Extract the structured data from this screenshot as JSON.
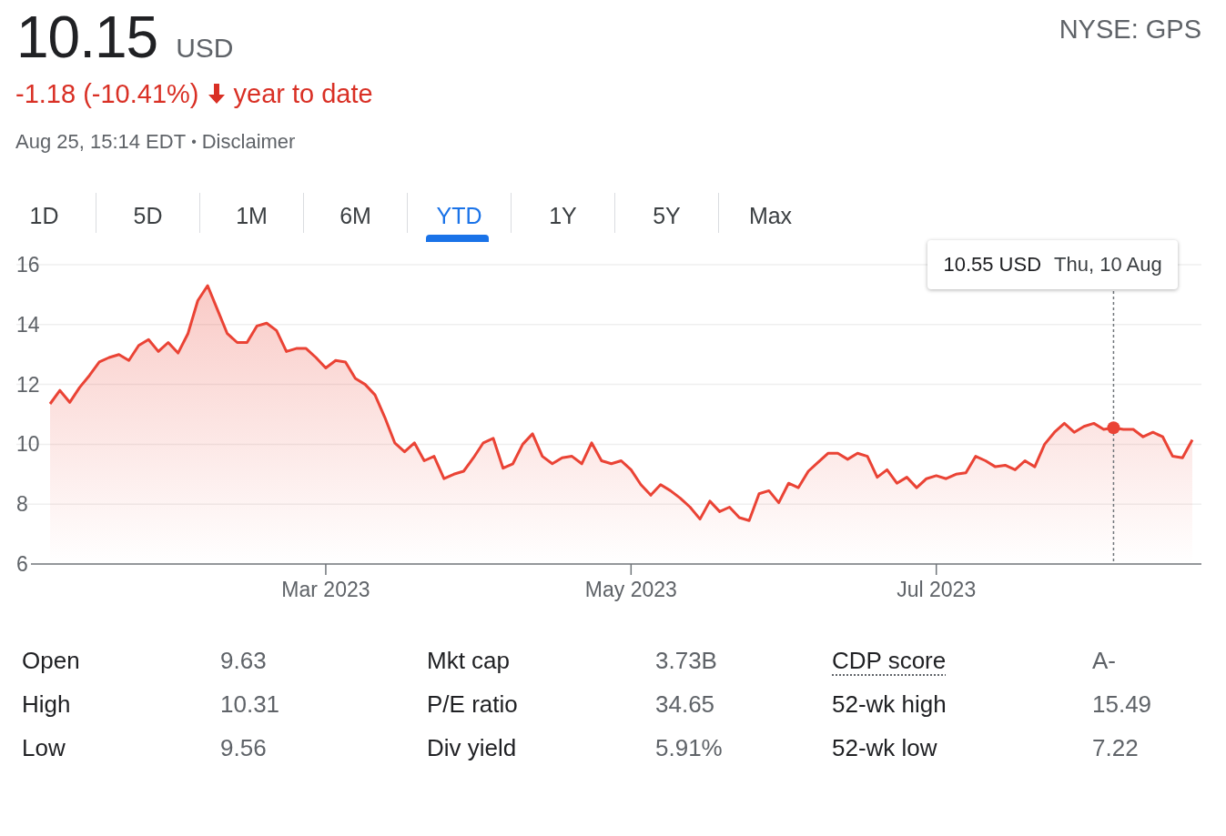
{
  "price": {
    "value": "10.15",
    "currency": "USD"
  },
  "ticker": "NYSE: GPS",
  "change": {
    "text": "-1.18 (-10.41%)",
    "negative": true,
    "period": "year to date"
  },
  "timestamp": "Aug 25, 15:14 EDT",
  "separator": "•",
  "disclaimer": "Disclaimer",
  "ranges": [
    {
      "label": "1D",
      "selected": false
    },
    {
      "label": "5D",
      "selected": false
    },
    {
      "label": "1M",
      "selected": false
    },
    {
      "label": "6M",
      "selected": false
    },
    {
      "label": "YTD",
      "selected": true
    },
    {
      "label": "1Y",
      "selected": false
    },
    {
      "label": "5Y",
      "selected": false
    },
    {
      "label": "Max",
      "selected": false
    }
  ],
  "chart": {
    "tooltip": {
      "date": "Thu, 10 Aug"
    },
    "chart_data": {
      "type": "area",
      "grid": true,
      "ylim": [
        6,
        16
      ],
      "yticks": [
        6,
        8,
        10,
        12,
        14,
        16
      ],
      "categories": [
        null,
        null,
        null,
        null,
        null,
        null,
        null,
        null,
        null,
        null,
        null,
        null,
        null,
        null,
        null,
        null,
        null,
        null,
        null,
        null,
        null,
        null,
        null,
        null,
        null,
        null,
        null,
        null,
        "Mar 2023",
        null,
        null,
        null,
        null,
        null,
        null,
        null,
        null,
        null,
        null,
        null,
        null,
        null,
        null,
        null,
        null,
        null,
        null,
        null,
        null,
        null,
        null,
        null,
        null,
        null,
        null,
        null,
        null,
        null,
        null,
        "May 2023",
        null,
        null,
        null,
        null,
        null,
        null,
        null,
        null,
        null,
        null,
        null,
        null,
        null,
        null,
        null,
        null,
        null,
        null,
        null,
        null,
        null,
        null,
        null,
        null,
        null,
        null,
        null,
        null,
        null,
        null,
        "Jul 2023",
        null,
        null,
        null,
        null,
        null,
        null,
        null,
        null,
        null,
        null,
        null,
        null,
        null,
        null,
        null,
        null,
        null,
        null,
        null,
        null,
        null,
        null,
        null,
        null,
        null,
        null
      ],
      "series": [
        {
          "color": "#ea4335",
          "values": [
            11.35,
            11.8,
            11.4,
            11.9,
            12.3,
            12.75,
            12.9,
            13.0,
            12.8,
            13.3,
            13.5,
            13.1,
            13.4,
            13.05,
            13.7,
            14.8,
            15.3,
            14.5,
            13.7,
            13.4,
            13.4,
            13.95,
            14.05,
            13.8,
            13.1,
            13.2,
            13.2,
            12.9,
            12.55,
            12.8,
            12.75,
            12.2,
            12.0,
            11.65,
            10.9,
            10.05,
            9.75,
            10.05,
            9.45,
            9.6,
            8.85,
            9.0,
            9.1,
            9.55,
            10.05,
            10.2,
            9.2,
            9.35,
            10.0,
            10.35,
            9.6,
            9.35,
            9.55,
            9.6,
            9.35,
            10.05,
            9.45,
            9.35,
            9.45,
            9.15,
            8.65,
            8.3,
            8.65,
            8.45,
            8.2,
            7.9,
            7.5,
            8.1,
            7.75,
            7.9,
            7.55,
            7.45,
            8.35,
            8.45,
            8.05,
            8.7,
            8.55,
            9.1,
            9.4,
            9.7,
            9.7,
            9.5,
            9.7,
            9.6,
            8.9,
            9.15,
            8.7,
            8.9,
            8.55,
            8.85,
            8.95,
            8.85,
            9.0,
            9.05,
            9.6,
            9.45,
            9.25,
            9.3,
            9.15,
            9.45,
            9.25,
            10.0,
            10.4,
            10.7,
            10.4,
            10.6,
            10.7,
            10.5,
            10.55,
            10.5,
            10.5,
            10.25,
            10.4,
            10.25,
            9.6,
            9.55,
            10.15
          ]
        }
      ],
      "annotations": [
        "10.55 USD"
      ]
    }
  },
  "stats": [
    {
      "label": "Open",
      "value": "9.63",
      "underlined": false
    },
    {
      "label": "Mkt cap",
      "value": "3.73B",
      "underlined": false
    },
    {
      "label": "CDP score",
      "value": "A-",
      "underlined": true
    },
    {
      "label": "High",
      "value": "10.31",
      "underlined": false
    },
    {
      "label": "P/E ratio",
      "value": "34.65",
      "underlined": false
    },
    {
      "label": "52-wk high",
      "value": "15.49",
      "underlined": false
    },
    {
      "label": "Low",
      "value": "9.56",
      "underlined": false
    },
    {
      "label": "Div yield",
      "value": "5.91%",
      "underlined": false
    },
    {
      "label": "52-wk low",
      "value": "7.22",
      "underlined": false
    }
  ]
}
